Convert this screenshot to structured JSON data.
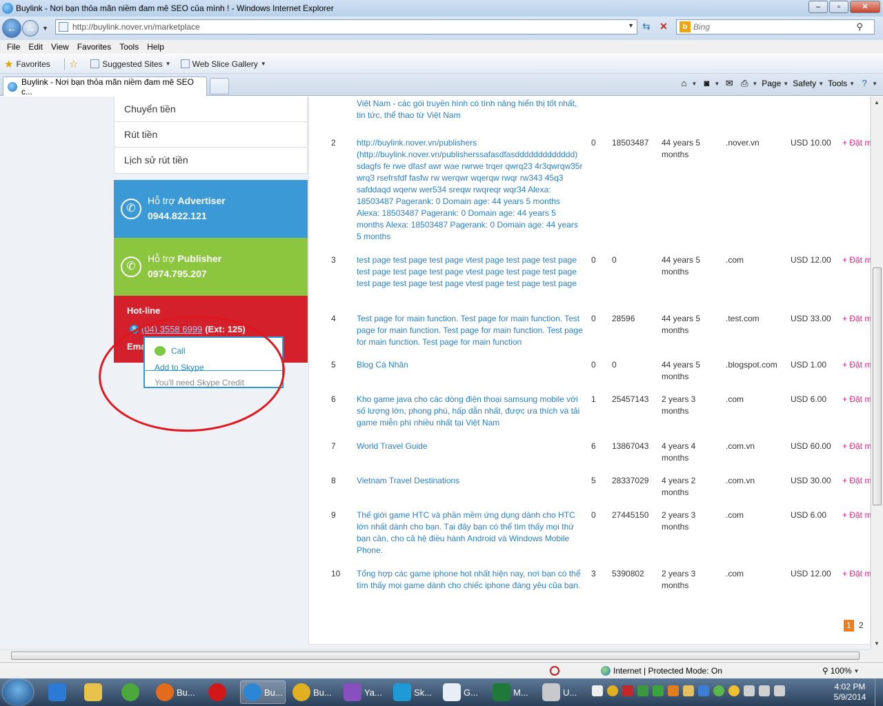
{
  "window": {
    "title": "Buylink - Nơi bạn thỏa mãn niềm đam mê SEO của mình ! - Windows Internet Explorer"
  },
  "address_bar": {
    "url": "http://buylink.nover.vn/marketplace",
    "search_placeholder": "Bing"
  },
  "menu": [
    "File",
    "Edit",
    "View",
    "Favorites",
    "Tools",
    "Help"
  ],
  "favorites_bar": {
    "favorites_label": "Favorites",
    "suggested_sites": "Suggested Sites",
    "web_slice_gallery": "Web Slice Gallery"
  },
  "tab": {
    "title": "Buylink - Nơi bạn thỏa mãn niềm đam mê SEO c..."
  },
  "command_bar": {
    "page": "Page",
    "safety": "Safety",
    "tools": "Tools"
  },
  "sidebar": {
    "menu": [
      "Chuyển tiền",
      "Rút tiền",
      "Lịch sử rút tiền"
    ],
    "advertiser": {
      "prefix": "Hỗ trợ ",
      "role": "Advertiser",
      "phone": "0944.822.121"
    },
    "publisher": {
      "prefix": "Hỗ trợ ",
      "role": "Publisher",
      "phone": "0974.795.207"
    },
    "hotline": {
      "label": "Hot-line",
      "number": "(04) 3558 6999",
      "ext": "(Ext: 125)",
      "email_label": "Ema"
    }
  },
  "skype_popup": {
    "call": "Call",
    "add": "Add to Skype",
    "credit": "You'll need Skype Credit"
  },
  "table_rows": [
    {
      "index": "",
      "site": "Việt Nam - các gói truyền hình có tính năng hiển thị tốt nhất, tin tức, thể thao từ Việt Nam",
      "pr": "",
      "alexa": "",
      "age": "",
      "domain": "",
      "price": "",
      "action": ""
    },
    {
      "index": "2",
      "site": "http://buylink.nover.vn/publishers (http://buylink.nover.vn/publisherssafasdfasddddddddddddd) sdagfs fe rwe dfasf awr wae rwrwe trqer qwrq23 4r3qwrqw35r wrq3 rsefrsfdf fasfw rw werqwr wqerqw rwqr rw343 45q3 safddaqd wqerw wer534 sreqw rwqreqr wqr34 Alexa: 18503487 Pagerank: 0 Domain age: 44 years 5 months Alexa: 18503487 Pagerank: 0 Domain age: 44 years 5 months Alexa: 18503487 Pagerank: 0 Domain age: 44 years 5 months",
      "pr": "0",
      "alexa": "18503487",
      "age": "44 years 5 months",
      "domain": ".nover.vn",
      "price": "USD 10.00",
      "action": "+ Đặt m"
    },
    {
      "index": "3",
      "site": "test page test page test page vtest page test page test page test page test page test page vtest page test page test page test page test page test page vtest page test page test page",
      "pr": "0",
      "alexa": "0",
      "age": "44 years 5 months",
      "domain": ".com",
      "price": "USD 12.00",
      "action": "+ Đặt m"
    },
    {
      "index": "4",
      "site": "Test page for main function. Test page for main function. Test page for main function. Test page for main function. Test page for main function. Test page for main function",
      "pr": "0",
      "alexa": "28596",
      "age": "44 years 5 months",
      "domain": ".test.com",
      "price": "USD 33.00",
      "action": "+ Đặt m"
    },
    {
      "index": "5",
      "site": "Blog Cá Nhân",
      "pr": "0",
      "alexa": "0",
      "age": "44 years 5 months",
      "domain": ".blogspot.com",
      "price": "USD 1.00",
      "action": "+ Đặt m"
    },
    {
      "index": "6",
      "site": "Kho game java cho các dòng điện thoại samsung mobile với số lượng lớn, phong phú, hấp dẫn nhất, được ưa thích và tải game miễn phí nhiều nhất tại Việt Nam",
      "pr": "1",
      "alexa": "25457143",
      "age": "2 years 3 months",
      "domain": ".com",
      "price": "USD 6.00",
      "action": "+ Đặt m"
    },
    {
      "index": "7",
      "site": "World Travel Guide",
      "pr": "6",
      "alexa": "13867043",
      "age": "4 years 4 months",
      "domain": ".com.vn",
      "price": "USD 60.00",
      "action": "+ Đặt m"
    },
    {
      "index": "8",
      "site": "Vietnam Travel Destinations",
      "pr": "5",
      "alexa": "28337029",
      "age": "4 years 2 months",
      "domain": ".com.vn",
      "price": "USD 30.00",
      "action": "+ Đặt m"
    },
    {
      "index": "9",
      "site": "Thế giới game HTC và phần mềm ứng dụng dành cho HTC lớn nhất dành cho bạn. Tại đây bạn có thể tìm thấy mọi thứ bạn cần, cho cả hệ điều hành Android và Windows Mobile Phone.",
      "pr": "0",
      "alexa": "27445150",
      "age": "2 years 3 months",
      "domain": ".com",
      "price": "USD 6.00",
      "action": "+ Đặt m"
    },
    {
      "index": "10",
      "site": "Tổng hợp các game iphone hot nhất hiện nay, nơi bạn có thể tìm thấy mọi game dành cho chiếc iphone đáng yêu của bạn.",
      "pr": "3",
      "alexa": "5390802",
      "age": "2 years 3 months",
      "domain": ".com",
      "price": "USD 12.00",
      "action": "+ Đặt m"
    }
  ],
  "pagination": {
    "current": "1",
    "next": "2"
  },
  "status_bar": {
    "zone": "Internet | Protected Mode: On",
    "zoom": "100%"
  },
  "taskbar": {
    "items": [
      "Bu...",
      "Bu...",
      "Bu...",
      "Ya...",
      "Sk...",
      "G...",
      "M...",
      "U..."
    ],
    "time": "4:02 PM",
    "date": "5/9/2014"
  }
}
